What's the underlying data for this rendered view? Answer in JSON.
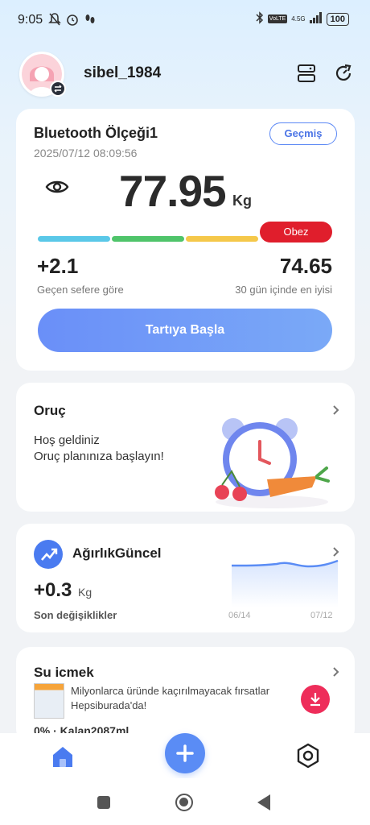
{
  "status_bar": {
    "time": "9:05",
    "network_label": "4.5G",
    "volte_label": "VoLTE",
    "battery": "100"
  },
  "header": {
    "username": "sibel_1984"
  },
  "weight_card": {
    "scale_name": "Bluetooth Ölçeği1",
    "timestamp": "2025/07/12 08:09:56",
    "history_label": "Geçmiş",
    "weight": "77.95",
    "unit": "Kg",
    "bmi_status": "Obez",
    "change_value": "+2.1",
    "change_label": "Geçen sefere göre",
    "best_value": "74.65",
    "best_label": "30 gün içinde en iyisi",
    "start_label": "Tartıya Başla",
    "bar_colors": [
      "#5ac8e8",
      "#4fc46a",
      "#f5c84a",
      "#e01e2c"
    ]
  },
  "fasting_card": {
    "title": "Oruç",
    "line1": "Hoş geldiniz",
    "line2": "Oruç planınıza başlayın!"
  },
  "trend_card": {
    "title": "AğırlıkGüncel",
    "value": "+0.3",
    "unit": "Kg",
    "label": "Son değişiklikler",
    "date_start": "06/14",
    "date_end": "07/12"
  },
  "water_card": {
    "title": "Su içmek",
    "progress": "0% · Kalan2087ml"
  },
  "ad": {
    "line1": "Milyonlarca üründe kaçırılmayacak fırsatlar",
    "line2": "Hepsiburada'da!"
  },
  "colors": {
    "accent": "#5a8cf5",
    "danger": "#e01e2c"
  }
}
